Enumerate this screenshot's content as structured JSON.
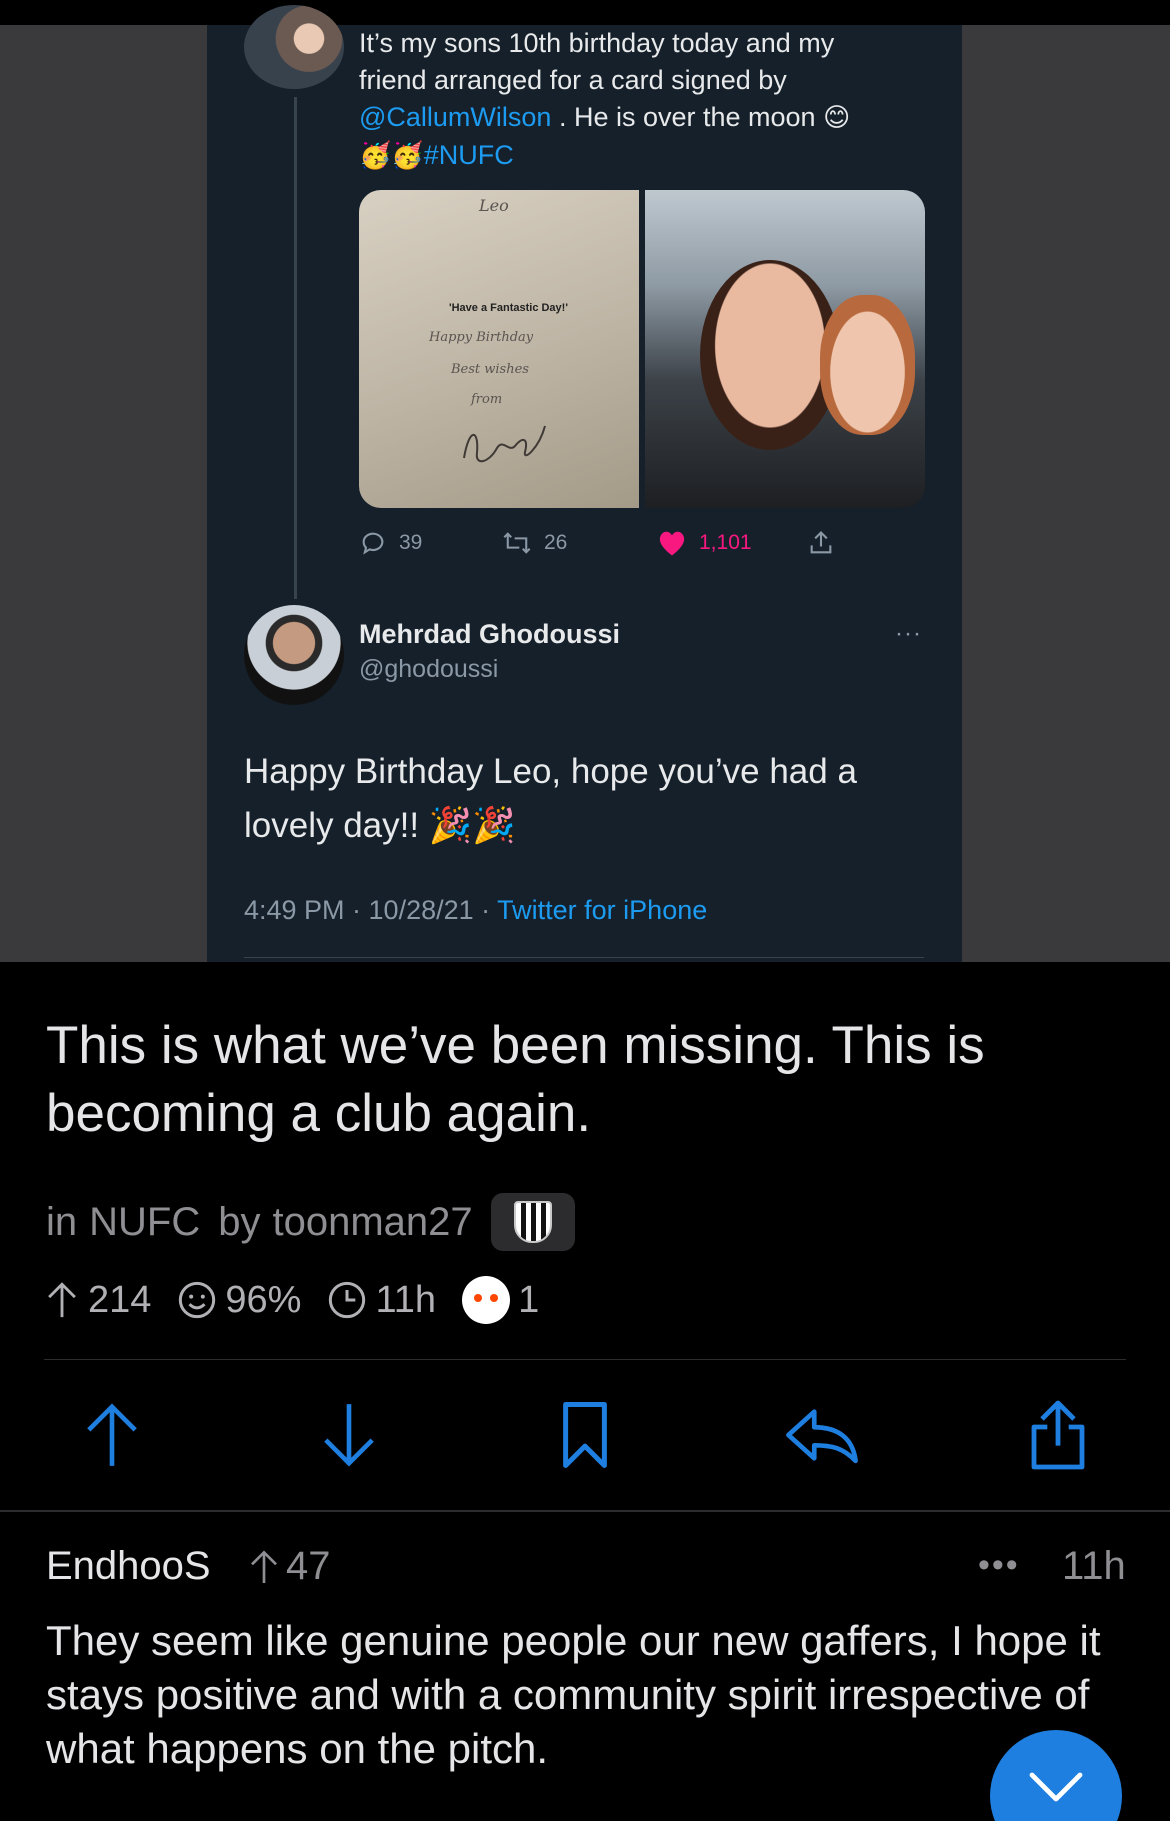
{
  "embedded_tweet": {
    "original_tweet": {
      "text_line1": "It’s my sons 10th birthday today and my",
      "text_line2": "friend arranged for a card signed by",
      "mention": "@CallumWilson",
      "text_line3_rest": " . He is over the moon ",
      "emoji_smile": "😊",
      "emoji_party_faces": "🥳🥳",
      "hashtag": "#NUFC",
      "card_text": {
        "name": "Leo",
        "printed": "'Have a Fantastic Day!'",
        "line1": "Happy Birthday",
        "line2": "Best wishes",
        "line3": "from"
      },
      "reply_count": "39",
      "retweet_count": "26",
      "like_count": "1,101"
    },
    "reply_tweet": {
      "author_name": "Mehrdad Ghodoussi",
      "author_handle": "@ghodoussi",
      "more": "···",
      "text": "Happy Birthday Leo, hope you’ve had a lovely day!! 🎉🎉",
      "timestamp": "4:49 PM · 10/28/21 · ",
      "source": "Twitter for iPhone"
    }
  },
  "post": {
    "title": "This is what we’ve been missing. This is becoming a club again.",
    "in_label": "in",
    "subreddit": "NUFC",
    "by_label": "by",
    "author": "toonman27",
    "upvotes": "214",
    "upvote_ratio": "96%",
    "age": "11h",
    "awards": "1"
  },
  "actions": {
    "icons": [
      "upvote-icon",
      "downvote-icon",
      "bookmark-icon",
      "reply-icon",
      "share-icon"
    ],
    "accent_color": "#1e7fe0"
  },
  "comment": {
    "author": "EndhooS",
    "score": "47",
    "more": "•••",
    "age": "11h",
    "body": "They seem like genuine people our new gaffers, I hope it stays positive and with a community spirit irrespective of what happens on the pitch."
  },
  "colors": {
    "background": "#000000",
    "tweet_background": "#15202b",
    "twitter_blue": "#1d9bf0",
    "like_pink": "#f91880",
    "muted_text": "#8e8e93"
  }
}
